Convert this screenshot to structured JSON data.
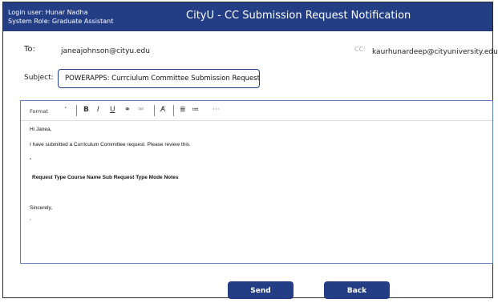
{
  "header": {
    "login_user": "Login user: Hunar Nadha",
    "system_role": "System Role: Graduate Assistant",
    "title": "CityU - CC Submission Request Notification"
  },
  "to": {
    "label": "To:",
    "value": "janeajohnson@cityu.edu"
  },
  "cc": {
    "label": "CC:",
    "value": "kaurhunardeep@cityuniversity.edu"
  },
  "subject": {
    "label": "Subject:",
    "value": "POWERAPPS: Currciulum Committee Submission Request"
  },
  "toolbar": {
    "format_label": "Format",
    "dropdown_glyph": "˅",
    "bold_glyph": "B",
    "italic_glyph": "I",
    "underline_glyph": "U",
    "link_glyph": "⚭",
    "unlink_glyph": "⚮",
    "clear_format_glyph": "A̸",
    "ordered_list_glyph": "≣",
    "bullet_list_glyph": "≔",
    "more_glyph": "···"
  },
  "body": {
    "greeting": "Hi Janea,",
    "line1": "I have submitted a Curriculum Committee request. Please review this.",
    "quote": "\"",
    "columns": "Request Type Course Name Sub Request Type Mode Notes",
    "closing": "Sincerely,",
    "trailing": ","
  },
  "buttons": {
    "send": "Send",
    "back": "Back"
  },
  "colors": {
    "brand": "#243e86",
    "editor_border": "#5f7cc4"
  }
}
